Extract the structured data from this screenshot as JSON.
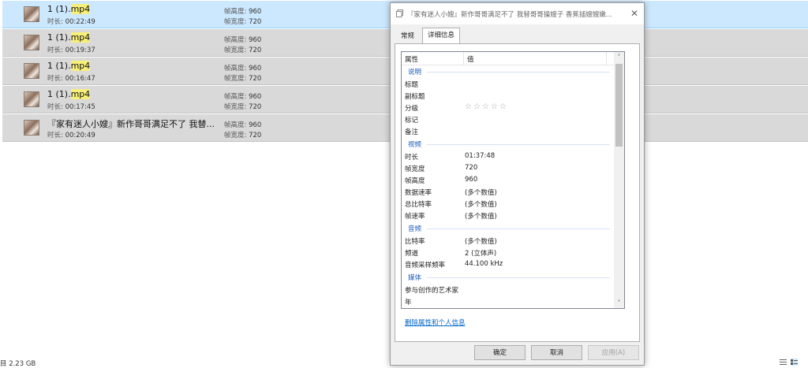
{
  "files": [
    {
      "name_base": "1 (1).",
      "name_ext": "mp4",
      "duration_label": "时长:",
      "duration": "00:22:49",
      "height_label": "帧高度:",
      "height": "960",
      "width_label": "帧宽度:",
      "width": "720",
      "selected": true
    },
    {
      "name_base": "1 (1).",
      "name_ext": "mp4",
      "duration_label": "时长:",
      "duration": "00:19:37",
      "height_label": "帧高度:",
      "height": "960",
      "width_label": "帧宽度:",
      "width": "720",
      "selected": false
    },
    {
      "name_base": "1 (1).",
      "name_ext": "mp4",
      "duration_label": "时长:",
      "duration": "00:16:47",
      "height_label": "帧高度:",
      "height": "960",
      "width_label": "帧宽度:",
      "width": "720",
      "selected": false
    },
    {
      "name_base": "1 (1).",
      "name_ext": "mp4",
      "duration_label": "时长:",
      "duration": "00:17:45",
      "height_label": "帧高度:",
      "height": "960",
      "width_label": "帧宽度:",
      "width": "720",
      "selected": false
    },
    {
      "name_base": "『家有迷人小嫂』新作哥哥满足不了 我替...",
      "name_ext": "",
      "duration_label": "时长:",
      "duration": "00:20:49",
      "height_label": "帧高度:",
      "height": "960",
      "width_label": "帧宽度:",
      "width": "720",
      "selected": false
    }
  ],
  "status_bar": {
    "text": "目 2.23 GB"
  },
  "dialog": {
    "title": "『家有迷人小嫂』新作哥哥满足不了 我替哥哥操嫂子 香蕉插嫂嫂嫩...",
    "tabs": [
      "常规",
      "详细信息"
    ],
    "active_tab": 1,
    "column_name": "属性",
    "column_value": "值",
    "groups": [
      {
        "label": "说明",
        "rows": [
          {
            "name": "标题",
            "value": ""
          },
          {
            "name": "副标题",
            "value": ""
          },
          {
            "name": "分级",
            "value": "☆☆☆☆☆"
          },
          {
            "name": "标记",
            "value": ""
          },
          {
            "name": "备注",
            "value": ""
          }
        ]
      },
      {
        "label": "视频",
        "rows": [
          {
            "name": "时长",
            "value": "01:37:48"
          },
          {
            "name": "帧宽度",
            "value": "720"
          },
          {
            "name": "帧高度",
            "value": "960"
          },
          {
            "name": "数据速率",
            "value": "(多个数值)"
          },
          {
            "name": "总比特率",
            "value": "(多个数值)"
          },
          {
            "name": "帧速率",
            "value": "(多个数值)"
          }
        ]
      },
      {
        "label": "音频",
        "rows": [
          {
            "name": "比特率",
            "value": "(多个数值)"
          },
          {
            "name": "频道",
            "value": "2 (立体声)"
          },
          {
            "name": "音频采样频率",
            "value": "44.100 kHz"
          }
        ]
      },
      {
        "label": "媒体",
        "rows": [
          {
            "name": "参与创作的艺术家",
            "value": ""
          },
          {
            "name": "年",
            "value": ""
          }
        ]
      }
    ],
    "remove_link": "删除属性和个人信息",
    "ok_label": "确定",
    "cancel_label": "取消",
    "apply_label": "应用(A)",
    "close_glyph": "✕",
    "scroll_up_glyph": "˄",
    "scroll_down_glyph": "˅"
  },
  "colors": {
    "selected_row": "#cce8ff",
    "row_bg": "#d9d9d9",
    "highlight": "#f6ef7a",
    "group_text": "#1e5bb8",
    "link": "#0066cc"
  }
}
